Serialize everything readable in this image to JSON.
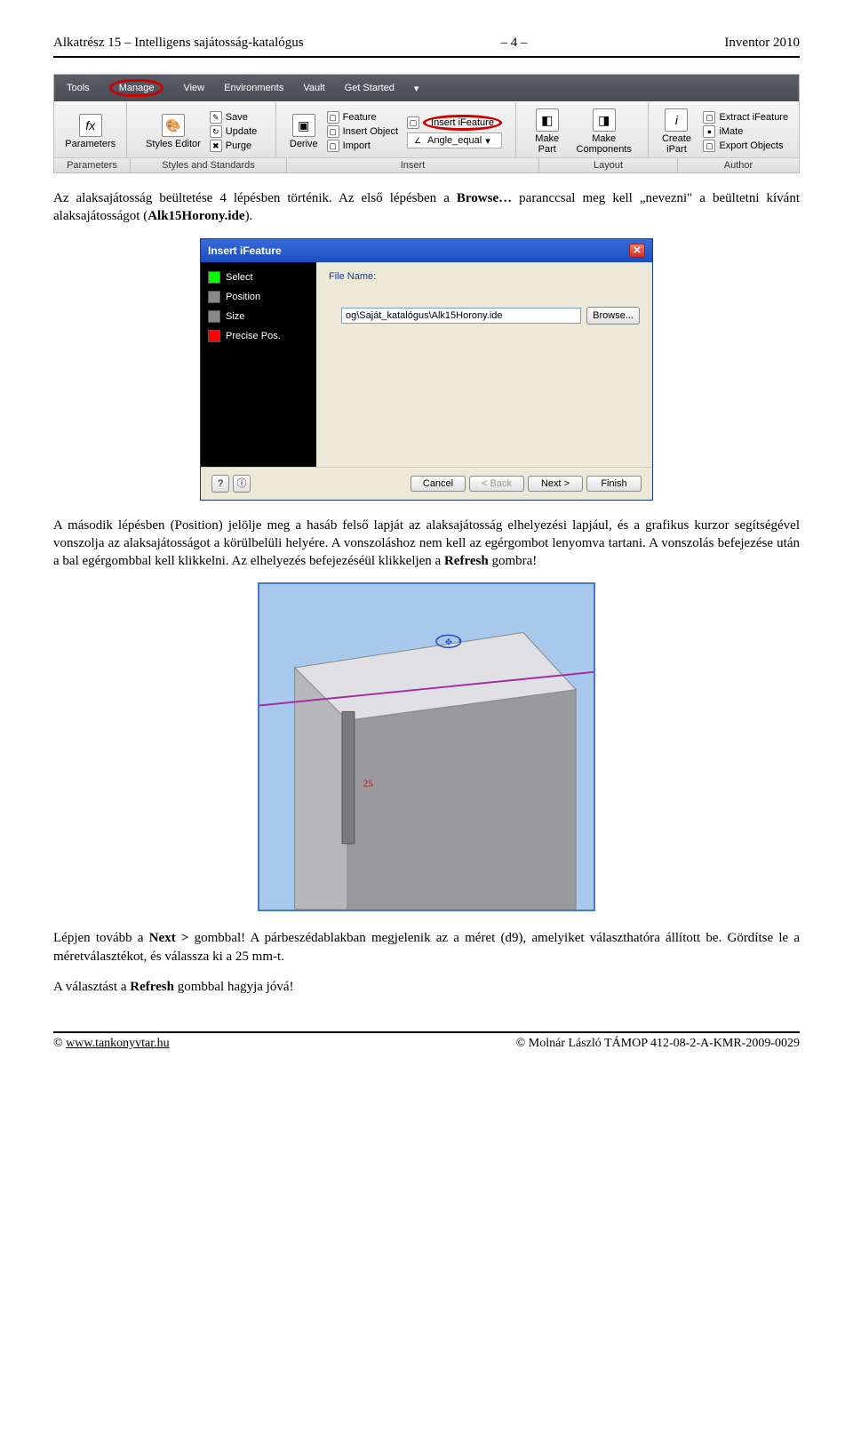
{
  "header": {
    "left": "Alkatrész 15 – Intelligens sajátosság-katalógus",
    "center": "– 4 –",
    "right": "Inventor 2010"
  },
  "menubar": {
    "items": [
      "Tools",
      "Manage",
      "View",
      "Environments",
      "Vault",
      "Get Started"
    ],
    "selected": 1
  },
  "ribbon": {
    "parameters": {
      "big": "Parameters",
      "icon": "fx"
    },
    "styles": {
      "big": "Styles Editor",
      "items": [
        "Save",
        "Update",
        "Purge"
      ]
    },
    "insert": {
      "big": "Derive",
      "items": [
        "Feature",
        "Insert Object",
        "Import"
      ],
      "highlighted": "Insert iFeature",
      "angle": "Angle_equal"
    },
    "layout": {
      "big1": "Make Part",
      "big2": "Make Components"
    },
    "author": {
      "big": "Create iPart",
      "items": [
        "Extract iFeature",
        "iMate",
        "Export Objects"
      ],
      "icon": "i"
    },
    "labels": [
      "Parameters",
      "Styles and Standards",
      "Insert",
      "Layout",
      "Author"
    ]
  },
  "para1_a": "Az alaksajátosság beültetése 4 lépésben történik. Az első lépésben a ",
  "para1_bold1": "Browse…",
  "para1_b": " paranccsal meg kell „nevezni\" a beültetni kívánt alaksajátosságot (",
  "para1_bold2": "Alk15Horony.ide",
  "para1_c": ").",
  "dialog": {
    "title": "Insert iFeature",
    "steps": [
      "Select",
      "Position",
      "Size",
      "Precise Pos."
    ],
    "file_label": "File Name:",
    "file_value": "og\\Saját_katalógus\\Alk15Horony.ide",
    "browse": "Browse...",
    "help": "?",
    "cancel": "Cancel",
    "back": "< Back",
    "next": "Next >",
    "finish": "Finish"
  },
  "para2": "A második lépésben (Position) jelölje meg a hasáb felső lapját az alaksajátosság elhelyezési lapjául, és a grafikus kurzor segítségével vonszolja az alaksajátosságot a körülbelüli helyére. A vonszoláshoz nem kell az egérgombot lenyomva tartani. A vonszolás befejezése után a bal egérgombbal kell klikkelni. Az elhelyezés befejezéséül klikkeljen a ",
  "para2_bold": "Refresh",
  "para2_end": " gombra!",
  "fig": {
    "dim": "25"
  },
  "para3_a": "Lépjen tovább a ",
  "para3_bold1": "Next >",
  "para3_b": " gombbal! A párbeszédablakban megjelenik az a méret (d9), amelyiket választhatóra állított be. Gördítse le a méretválasztékot, és válassza ki a 25 mm-t.",
  "para4_a": "A választást a ",
  "para4_bold": "Refresh",
  "para4_b": " gombbal hagyja jóvá!",
  "footer": {
    "left_sym": "©",
    "left_link": "www.tankonyvtar.hu",
    "right": "© Molnár László TÁMOP 412-08-2-A-KMR-2009-0029"
  }
}
